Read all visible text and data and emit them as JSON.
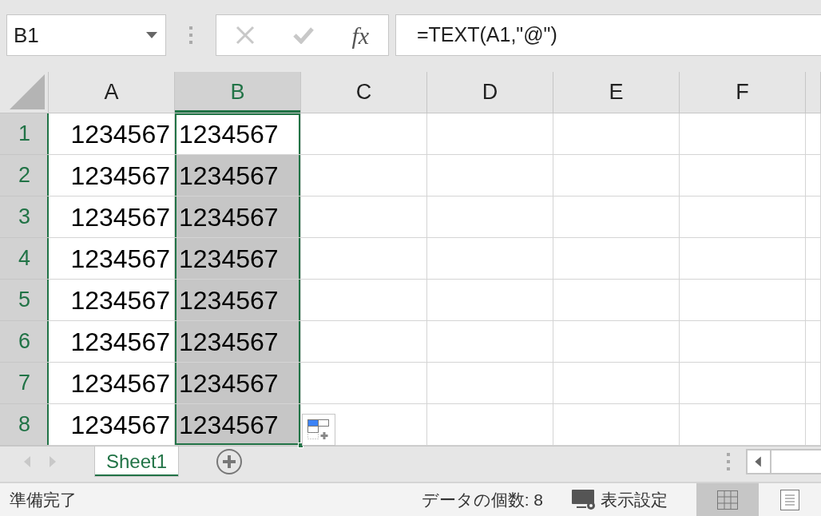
{
  "name_box": {
    "value": "B1"
  },
  "formula_bar": {
    "fx_label": "fx",
    "value": "=TEXT(A1,\"@\")"
  },
  "columns": [
    {
      "label": "A",
      "selected": false
    },
    {
      "label": "B",
      "selected": true
    },
    {
      "label": "C",
      "selected": false
    },
    {
      "label": "D",
      "selected": false
    },
    {
      "label": "E",
      "selected": false
    },
    {
      "label": "F",
      "selected": false
    }
  ],
  "rows": [
    {
      "label": "1",
      "selected": true,
      "cells": [
        {
          "kind": "number",
          "value": "1234567",
          "selected": false,
          "active": false
        },
        {
          "kind": "text",
          "value": "1234567",
          "selected": true,
          "active": true
        }
      ]
    },
    {
      "label": "2",
      "selected": true,
      "cells": [
        {
          "kind": "number",
          "value": "1234567",
          "selected": false,
          "active": false
        },
        {
          "kind": "text",
          "value": "1234567",
          "selected": true,
          "active": false
        }
      ]
    },
    {
      "label": "3",
      "selected": true,
      "cells": [
        {
          "kind": "number",
          "value": "1234567",
          "selected": false,
          "active": false
        },
        {
          "kind": "text",
          "value": "1234567",
          "selected": true,
          "active": false
        }
      ]
    },
    {
      "label": "4",
      "selected": true,
      "cells": [
        {
          "kind": "number",
          "value": "1234567",
          "selected": false,
          "active": false
        },
        {
          "kind": "text",
          "value": "1234567",
          "selected": true,
          "active": false
        }
      ]
    },
    {
      "label": "5",
      "selected": true,
      "cells": [
        {
          "kind": "number",
          "value": "1234567",
          "selected": false,
          "active": false
        },
        {
          "kind": "text",
          "value": "1234567",
          "selected": true,
          "active": false
        }
      ]
    },
    {
      "label": "6",
      "selected": true,
      "cells": [
        {
          "kind": "number",
          "value": "1234567",
          "selected": false,
          "active": false
        },
        {
          "kind": "text",
          "value": "1234567",
          "selected": true,
          "active": false
        }
      ]
    },
    {
      "label": "7",
      "selected": true,
      "cells": [
        {
          "kind": "number",
          "value": "1234567",
          "selected": false,
          "active": false
        },
        {
          "kind": "text",
          "value": "1234567",
          "selected": true,
          "active": false
        }
      ]
    },
    {
      "label": "8",
      "selected": true,
      "cells": [
        {
          "kind": "number",
          "value": "1234567",
          "selected": false,
          "active": false
        },
        {
          "kind": "text",
          "value": "1234567",
          "selected": true,
          "active": false
        }
      ]
    }
  ],
  "sheet_tabs": [
    {
      "label": "Sheet1",
      "selected": true
    }
  ],
  "status_bar": {
    "ready": "準備完了",
    "count": "データの個数: 8",
    "display_settings": "表示設定",
    "views": [
      {
        "kind": "normal",
        "selected": true
      },
      {
        "kind": "page_layout",
        "selected": false
      }
    ]
  }
}
